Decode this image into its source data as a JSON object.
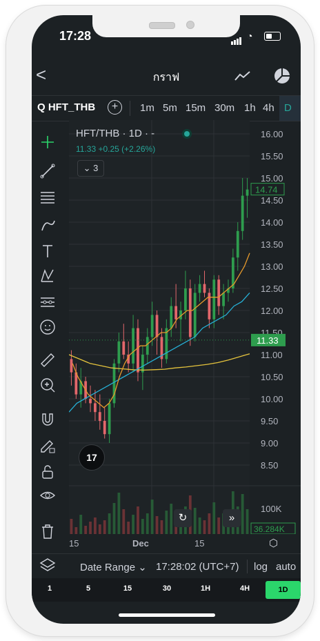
{
  "status": {
    "time": "17:28"
  },
  "nav": {
    "back_label": "<",
    "title": "กราฟ"
  },
  "symbol": {
    "name": "Q HFT_THB"
  },
  "timeframes": [
    "1m",
    "5m",
    "15m",
    "30m",
    "1h",
    "4h",
    "D"
  ],
  "legend": {
    "title": "HFT/THB · 1D · -",
    "values": "11.33 +0.25 (+2.26%)",
    "indicators_toggle": "3"
  },
  "price_axis": {
    "ticks": [
      "16.00",
      "15.50",
      "15.00",
      "14.50",
      "14.00",
      "13.50",
      "13.00",
      "12.50",
      "12.00",
      "11.50",
      "11.00",
      "10.50",
      "10.00",
      "9.50",
      "9.00",
      "8.50"
    ],
    "last_price": "11.33",
    "high_tag": "14.74",
    "volume_tick": "100K",
    "volume_tag": "36.284K"
  },
  "x_axis": {
    "labels": [
      "15",
      "Dec",
      "15"
    ]
  },
  "bottom_bar": {
    "date_range": "Date Range",
    "time": "17:28:02 (UTC+7)",
    "log": "log",
    "auto": "auto"
  },
  "resolutions": [
    "1",
    "5",
    "15",
    "30",
    "1H",
    "4H",
    "1D"
  ],
  "tv_logo": "17",
  "colors": {
    "up": "#2e9d4e",
    "down": "#e3676b",
    "ma_fast": "#e79a2c",
    "ma_slow": "#26b0d6",
    "ma_long": "#e6c43d",
    "accent": "#2bd66b"
  },
  "icons": [
    "crosshair-icon",
    "trendline-icon",
    "fib-icon",
    "brush-icon",
    "text-icon",
    "pattern-icon",
    "forecast-icon",
    "emoji-icon",
    "ruler-icon",
    "zoom-in-icon",
    "magnet-icon",
    "lock-draw-icon",
    "unlock-icon",
    "eye-icon",
    "trash-icon",
    "layers-icon"
  ],
  "chart_data": {
    "type": "candlestick",
    "ylim": [
      8.5,
      16.0
    ],
    "series": [
      {
        "name": "Price",
        "values": [
          [
            10.9,
            11.1,
            10.3,
            10.6
          ],
          [
            10.6,
            10.8,
            10.0,
            10.1
          ],
          [
            10.1,
            10.7,
            9.8,
            10.4
          ],
          [
            10.4,
            10.5,
            9.9,
            10.0
          ],
          [
            10.0,
            10.3,
            9.7,
            9.9
          ],
          [
            9.9,
            10.2,
            9.5,
            9.7
          ],
          [
            9.7,
            10.1,
            9.3,
            9.5
          ],
          [
            9.5,
            9.8,
            9.1,
            9.2
          ],
          [
            9.2,
            10.0,
            9.0,
            9.9
          ],
          [
            9.9,
            10.9,
            9.8,
            10.8
          ],
          [
            10.8,
            11.5,
            10.6,
            11.3
          ],
          [
            11.3,
            11.7,
            10.9,
            11.0
          ],
          [
            11.0,
            11.3,
            10.6,
            10.8
          ],
          [
            10.8,
            11.9,
            10.6,
            11.6
          ],
          [
            11.6,
            11.8,
            10.4,
            10.6
          ],
          [
            10.6,
            11.2,
            10.2,
            11.0
          ],
          [
            11.0,
            11.6,
            10.8,
            11.4
          ],
          [
            11.4,
            12.2,
            11.2,
            11.9
          ],
          [
            11.9,
            12.0,
            11.0,
            11.4
          ],
          [
            11.4,
            11.6,
            10.7,
            10.9
          ],
          [
            10.9,
            11.8,
            10.8,
            11.6
          ],
          [
            11.6,
            12.3,
            11.4,
            12.1
          ],
          [
            12.1,
            12.6,
            11.6,
            11.8
          ],
          [
            11.8,
            12.2,
            11.3,
            12.0
          ],
          [
            12.0,
            12.9,
            11.8,
            12.5
          ],
          [
            12.5,
            12.7,
            11.2,
            11.4
          ],
          [
            11.4,
            12.6,
            11.3,
            12.4
          ],
          [
            12.4,
            12.8,
            12.2,
            12.6
          ],
          [
            12.6,
            12.9,
            12.3,
            12.4
          ],
          [
            12.4,
            12.5,
            11.6,
            11.8
          ],
          [
            11.8,
            12.8,
            11.6,
            12.7
          ],
          [
            12.7,
            12.8,
            11.9,
            12.1
          ],
          [
            12.1,
            12.6,
            11.8,
            12.4
          ],
          [
            12.4,
            12.7,
            12.2,
            12.5
          ],
          [
            12.5,
            13.4,
            12.4,
            13.2
          ],
          [
            13.2,
            14.0,
            12.9,
            13.8
          ],
          [
            13.8,
            15.0,
            13.6,
            14.6
          ],
          [
            14.6,
            15.0,
            14.1,
            14.74
          ]
        ]
      },
      {
        "name": "MA fast",
        "values": [
          10.8,
          10.5,
          10.3,
          10.1,
          10.0,
          9.9,
          9.8,
          9.9,
          10.1,
          10.5,
          10.8,
          11.0,
          11.1,
          11.2,
          11.2,
          11.3,
          11.4,
          11.5,
          11.5,
          11.6,
          11.8,
          11.9,
          12.0,
          12.0,
          12.1,
          12.2,
          12.3,
          12.3,
          12.3,
          12.4,
          12.5,
          12.6,
          12.8,
          13.0,
          13.3
        ]
      },
      {
        "name": "MA slow",
        "values": [
          9.7,
          9.9,
          10.0,
          10.1,
          10.2,
          10.3,
          10.4,
          10.5,
          10.6,
          10.7,
          10.8,
          10.9,
          11.0,
          11.1,
          11.2,
          11.3,
          11.4,
          11.6,
          11.7,
          11.8,
          11.9,
          12.1,
          12.2,
          12.4
        ]
      },
      {
        "name": "MA long",
        "values": [
          11.0,
          10.9,
          10.8,
          10.75,
          10.7,
          10.68,
          10.66,
          10.65,
          10.66,
          10.67,
          10.7,
          10.72,
          10.75,
          10.78,
          10.82,
          10.88,
          10.95,
          11.02
        ]
      }
    ]
  }
}
